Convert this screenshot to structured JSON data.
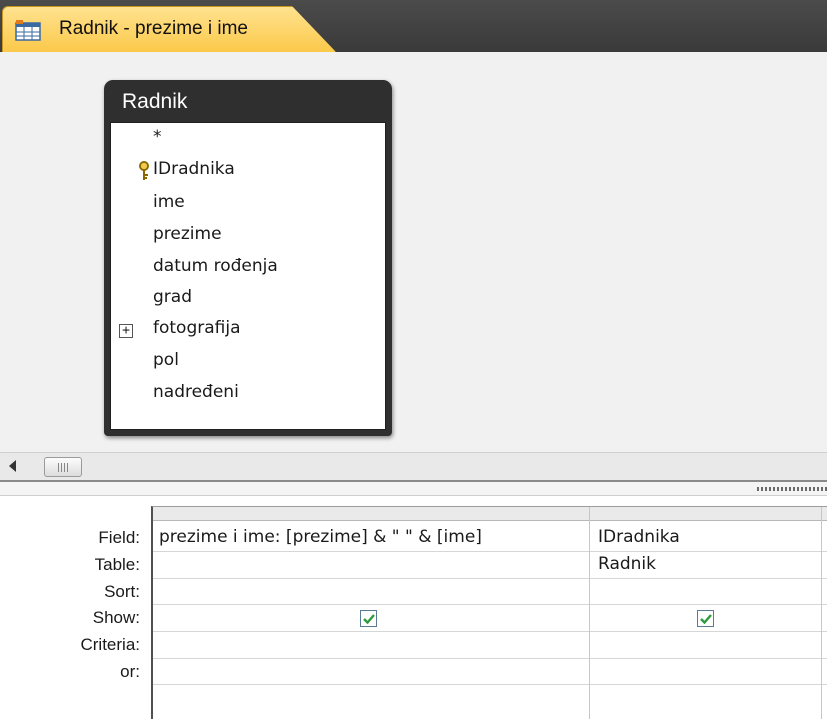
{
  "tab": {
    "title": "Radnik - prezime i ime",
    "icon": "query-icon"
  },
  "table_box": {
    "title": "Radnik",
    "fields": [
      {
        "label": "*"
      },
      {
        "label": "IDradnika",
        "primary_key": true
      },
      {
        "label": "ime"
      },
      {
        "label": "prezime"
      },
      {
        "label": "datum rođenja"
      },
      {
        "label": "grad"
      },
      {
        "label": "fotografija",
        "expandable": true
      },
      {
        "label": "pol"
      },
      {
        "label": "nadređeni"
      }
    ]
  },
  "grid": {
    "row_labels": {
      "field": "Field:",
      "table": "Table:",
      "sort": "Sort:",
      "show": "Show:",
      "criteria": "Criteria:",
      "or": "or:"
    },
    "columns": [
      {
        "field": "prezime i ime: [prezime] & \" \" & [ime]",
        "table": "",
        "sort": "",
        "show": true,
        "criteria": "",
        "or": ""
      },
      {
        "field": "IDradnika",
        "table": "Radnik",
        "sort": "",
        "show": true,
        "criteria": "",
        "or": ""
      }
    ]
  },
  "colors": {
    "tab_active": "#fbc94a",
    "tab_bar": "#3d3d3d",
    "table_box_header": "#2f2f2f",
    "checkbox_check": "#2e9c3d",
    "design_background": "#f1f1f1"
  }
}
